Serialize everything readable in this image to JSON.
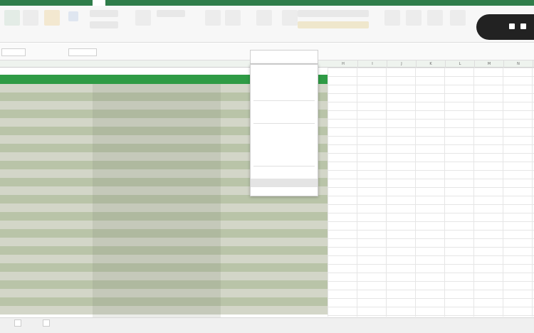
{
  "ribbon_tabs": [
    "",
    "",
    "",
    "",
    "",
    "",
    "",
    "",
    "",
    "",
    "",
    "",
    ""
  ],
  "active_tab_index": 3,
  "formula_bar": {
    "name_box": "",
    "formula": ""
  },
  "columns": [
    "H",
    "I",
    "J",
    "K",
    "L",
    "M",
    "N",
    "O"
  ],
  "context_menu": {
    "items": [
      "",
      "",
      "",
      "",
      "",
      "",
      "",
      "",
      "",
      "",
      "",
      "",
      ""
    ],
    "highlighted_index": 11
  },
  "sheet_tabs": [
    "",
    ""
  ],
  "recording_pill": {
    "label": ""
  },
  "subtitle": "",
  "colors": {
    "accent": "#2f7d4a",
    "header_band": "#2f9b45",
    "link": "#3a78c9"
  }
}
